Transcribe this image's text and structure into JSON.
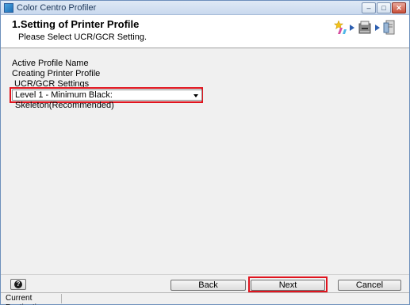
{
  "window": {
    "title": "Color Centro Profiler",
    "controls": {
      "minimize": "–",
      "maximize": "□",
      "close": "✕"
    }
  },
  "header": {
    "step_title": "1.Setting of Printer Profile",
    "step_subtitle": "Please Select UCR/GCR Setting.",
    "workflow_icons": [
      "star-pen-icon",
      "printer-icon",
      "document-icon"
    ]
  },
  "content": {
    "active_profile_label": "Active Profile Name",
    "creating_label": "Creating Printer Profile",
    "ucr_gcr_label": "UCR/GCR Settings",
    "ucr_gcr_selected": "Level 1 - Minimum Black: Skeleton(Recommended)"
  },
  "buttons": {
    "help": "?",
    "back": "Back",
    "next": "Next",
    "cancel": "Cancel"
  },
  "status": {
    "destination": "Current Destination"
  },
  "colors": {
    "highlight": "#e0141e",
    "title_text": "#1e395b"
  }
}
